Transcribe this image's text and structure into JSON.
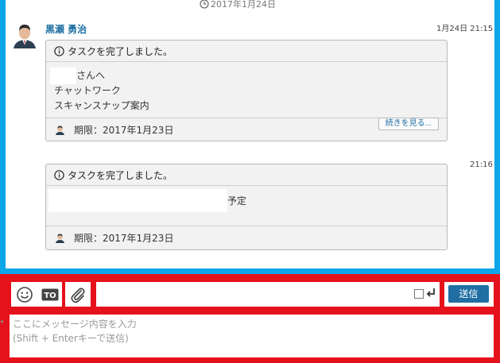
{
  "chat": {
    "date_separator": "2017年1月24日",
    "sender_name": "黒瀬 勇治",
    "messages": [
      {
        "time": "1月24日 21:15",
        "header": "タスクを完了しました。",
        "lines": [
          "さんへ",
          "チャットワーク",
          "スキャンスナップ案内"
        ],
        "deadline": "期限：2017年1月23日",
        "more_label": "続きを見る..."
      },
      {
        "time": "21:16",
        "header": "タスクを完了しました。",
        "lines": [
          "予定"
        ],
        "deadline": "期限：2017年1月23日"
      }
    ]
  },
  "composer": {
    "emoji_icon": "smiley-icon",
    "to_label": "TO",
    "attach_icon": "paperclip-icon",
    "send_label": "送信",
    "placeholder": "ここにメッセージ内容を入力\n(Shift + Enterキーで送信)"
  },
  "colors": {
    "frame_blue": "#0ea5e9",
    "frame_red": "#e5121b",
    "accent": "#1f6fa3"
  }
}
